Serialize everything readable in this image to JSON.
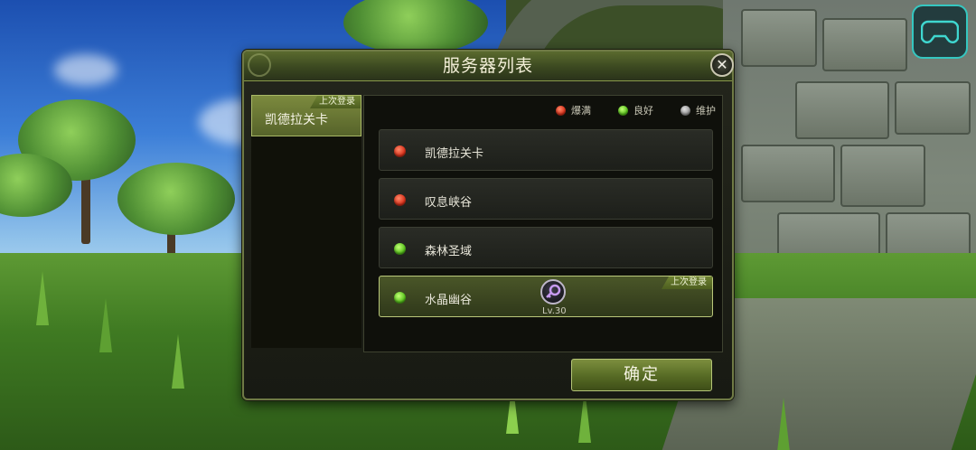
{
  "dialog": {
    "title": "服务器列表",
    "close_icon": "close-icon"
  },
  "region_tab": {
    "name": "凯德拉关卡",
    "tag": "上次登录"
  },
  "legend": [
    {
      "label": "爆满",
      "color": "#d9311b"
    },
    {
      "label": "良好",
      "color": "#58c21c"
    },
    {
      "label": "维护",
      "color": "#9a9a9a"
    }
  ],
  "servers": [
    {
      "name": "凯德拉关卡",
      "status": "red"
    },
    {
      "name": "叹息峡谷",
      "status": "red"
    },
    {
      "name": "森林圣域",
      "status": "green"
    },
    {
      "name": "水晶幽谷",
      "status": "green",
      "selected": true,
      "tag": "上次登录",
      "character_level": "Lv.30",
      "character_icon": "key-icon"
    }
  ],
  "confirm_label": "确定",
  "top_right_button_icon": "gamepad-icon"
}
